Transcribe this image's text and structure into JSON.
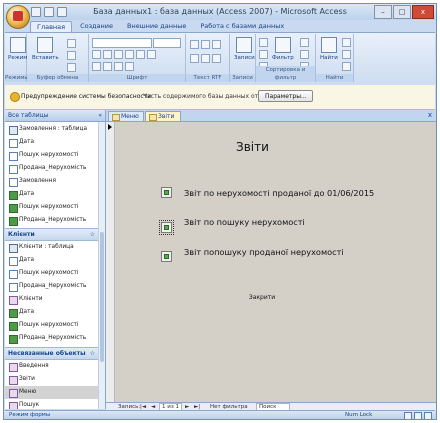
{
  "window": {
    "title": "База данных1 : база данных (Access 2007) - Microsoft Access",
    "controls": [
      "–",
      "□",
      "x"
    ]
  },
  "ribbon_tabs": [
    "Главная",
    "Создание",
    "Внешние данные",
    "Работа с базами данных"
  ],
  "ribbon_groups": {
    "views": "Режимы",
    "clipboard": "Буфер обмена",
    "font": "Шрифт",
    "rtf": "Текст RTF",
    "records": "Записи",
    "sort_filter": "Сортировка и фильтр",
    "find": "Найти"
  },
  "ribbon_buttons": {
    "view": "Режим",
    "paste": "Вставить",
    "records": "Записи",
    "filter": "Фильтр",
    "find": "Найти"
  },
  "security": {
    "title": "Предупреждение системы безопасности",
    "message": "Часть содержимого базы данных отключено",
    "button": "Параметры..."
  },
  "nav": {
    "header": "Все таблицы",
    "header_ctrl": "«",
    "items_top": [
      {
        "label": "Замовлення : таблица",
        "kind": "t"
      },
      {
        "label": "Дата",
        "kind": "q"
      },
      {
        "label": "Пошук нерухомості",
        "kind": "q"
      },
      {
        "label": "Продана_Нерухомість",
        "kind": "q"
      },
      {
        "label": "Замовлення",
        "kind": "q"
      },
      {
        "label": "Дата",
        "kind": "r"
      },
      {
        "label": "Пошук нерухомості",
        "kind": "r"
      },
      {
        "label": "ПРодана_Нерухомість",
        "kind": "r"
      }
    ],
    "group_clients": {
      "label": "Клієнти",
      "ctrl": "☆"
    },
    "items_clients": [
      {
        "label": "Клієнти : таблица",
        "kind": "t"
      },
      {
        "label": "Дата",
        "kind": "q"
      },
      {
        "label": "Пошук нерухомості",
        "kind": "q"
      },
      {
        "label": "Продана_Нерухомість",
        "kind": "q"
      },
      {
        "label": "Клієнти",
        "kind": "f"
      },
      {
        "label": "Дата",
        "kind": "r"
      },
      {
        "label": "Пошук нерухомості",
        "kind": "r"
      },
      {
        "label": "ПРодана_Нерухомість",
        "kind": "r"
      }
    ],
    "group_unlinked": {
      "label": "Несвязанные объекты",
      "ctrl": "☆"
    },
    "items_unlinked": [
      {
        "label": "Введення",
        "kind": "f"
      },
      {
        "label": "Звіти",
        "kind": "f"
      },
      {
        "label": "Меню",
        "kind": "f"
      },
      {
        "label": "Пошук",
        "kind": "f"
      }
    ]
  },
  "doc_tabs": [
    "Меню",
    "Звіти"
  ],
  "doc_close": "x",
  "form": {
    "title": "Звіти",
    "options": [
      "Звіт по нерухомості проданої до 01/06/2015",
      "Звіт по пошуку нерухомості",
      "Звіт попошуку проданої нерухомості"
    ],
    "close_button": "Закрити"
  },
  "record_nav": {
    "label": "Запись:",
    "nav_first": "|◄",
    "nav_prev": "◄",
    "position": "1 из 1",
    "nav_next": "►",
    "nav_last": "►|",
    "filter": "Нет фильтра",
    "search": "Поиск"
  },
  "status": {
    "left": "Режим формы",
    "numlock": "Num Lock"
  }
}
